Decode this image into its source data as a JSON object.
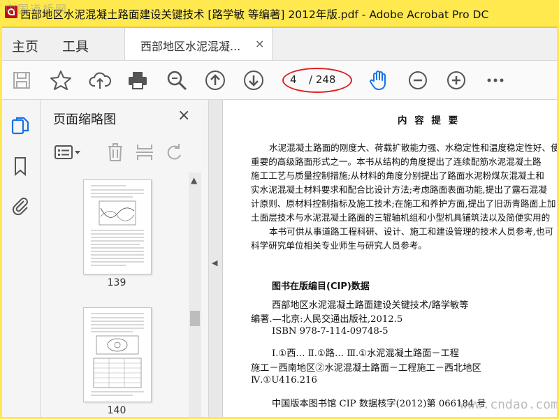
{
  "window": {
    "title": "西部地区水泥混凝土路面建设关键技术 [路学敏 等编著] 2012年版.pdf - Adobe Acrobat Pro DC",
    "watermark_top": "中国道桥网"
  },
  "menu": {
    "home": "主页",
    "tools": "工具"
  },
  "tab": {
    "label": "西部地区水泥混凝...",
    "close": "×"
  },
  "toolbar": {
    "icons": [
      "save-icon",
      "star-icon",
      "cloud-upload-icon",
      "print-icon",
      "zoom-out-search-icon",
      "page-up-icon",
      "page-down-icon",
      "hand-tool-icon",
      "zoom-minus-icon",
      "zoom-plus-icon",
      "more-icon"
    ],
    "page_current": "4",
    "page_total": "/ 248",
    "hand_color": "#1473e6",
    "highlight_color": "#e02020"
  },
  "sidebar": {
    "panel_title": "页面缩略图",
    "close": "×",
    "thumbnails": [
      {
        "page": "139"
      },
      {
        "page": "140"
      }
    ]
  },
  "document": {
    "heading": "内 容 提 要",
    "paragraphs": [
      "水泥混凝土路面的刚度大、荷载扩散能力强、水稳定性和温度稳定性好、使",
      "重要的高级路面形式之一。本书从结构的角度提出了连续配筋水泥混凝土路",
      "施工工艺与质量控制措施;从材料的角度分别提出了路面水泥粉煤灰混凝土和",
      "实水泥混凝土材料要求和配合比设计方法;考虑路面表面功能,提出了露石混凝",
      "计原则、原材料控制指标及施工技术;在施工和养护方面,提出了旧沥青路面上加",
      "土面层技术与水泥混凝土路面的三辊轴机组和小型机具铺筑法以及简便实用的",
      "本书可供从事道路工程科研、设计、施工和建设管理的技术人员参考,也可",
      "科学研究单位相关专业师生与研究人员参考。"
    ],
    "cip_heading": "图书在版编目(CIP)数据",
    "cip_lines": [
      "西部地区水泥混凝土路面建设关键技术/路学敏等",
      "编著.—北京:人民交通出版社,2012.5",
      "ISBN  978-7-114-09748-5",
      "Ⅰ.①西…  Ⅱ.①路…  Ⅲ.①水泥混凝土路面－工程",
      "施工－西南地区②水泥混凝土路面－工程施工－西北地区",
      "Ⅳ.①U416.216",
      "中国版本图书馆 CIP 数据核字(2012)第 066184 号"
    ],
    "watermark_bottom": "www.cndao.com"
  }
}
